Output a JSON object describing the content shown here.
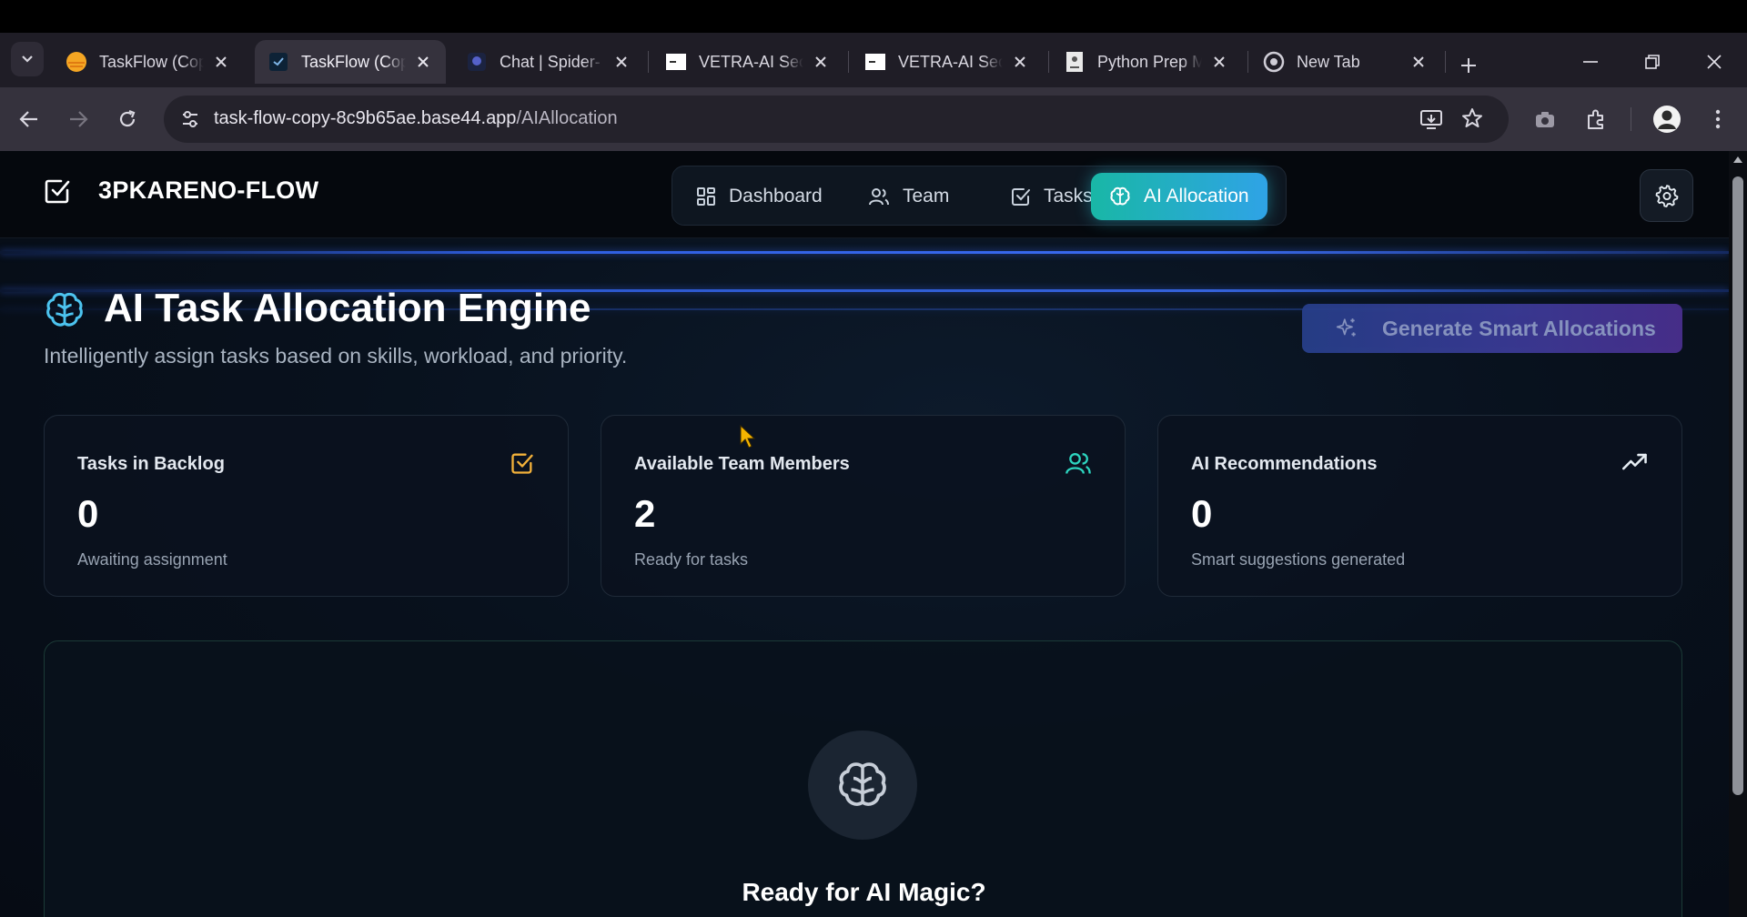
{
  "browser": {
    "tabs": [
      {
        "title": "TaskFlow (Cop",
        "favicon": "orange-circle-icon",
        "active": false
      },
      {
        "title": "TaskFlow (Cop",
        "favicon": "taskflow-icon",
        "active": true
      },
      {
        "title": "Chat | Spider-",
        "favicon": "chat-icon",
        "active": false
      },
      {
        "title": "VETRA-AI Sec",
        "favicon": "page-icon",
        "active": false
      },
      {
        "title": "VETRA-AI Sec",
        "favicon": "page-icon",
        "active": false
      },
      {
        "title": "Python Prep M",
        "favicon": "document-icon",
        "active": false
      },
      {
        "title": "New Tab",
        "favicon": "chrome-icon",
        "active": false
      }
    ],
    "url_host": "task-flow-copy-8c9b65ae.base44.app",
    "url_path": "/AIAllocation"
  },
  "app": {
    "brand": "3PKARENO-FLOW",
    "nav": {
      "dashboard": "Dashboard",
      "team": "Team",
      "tasks": "Tasks",
      "ai_allocation": "AI Allocation"
    },
    "active_nav": "AI Allocation"
  },
  "hero": {
    "title": "AI Task Allocation Engine",
    "subtitle": "Intelligently assign tasks based on skills, workload, and priority.",
    "generate_button": "Generate Smart Allocations"
  },
  "stats": [
    {
      "label": "Tasks in Backlog",
      "value": "0",
      "note": "Awaiting assignment",
      "icon": "check-square-icon",
      "icon_color": "#f2b13a"
    },
    {
      "label": "Available Team Members",
      "value": "2",
      "note": "Ready for tasks",
      "icon": "users-icon",
      "icon_color": "#2dd4bf"
    },
    {
      "label": "AI Recommendations",
      "value": "0",
      "note": "Smart suggestions generated",
      "icon": "trending-up-icon",
      "icon_color": "#e6edf3"
    }
  ],
  "empty_state": {
    "title": "Ready for AI Magic?",
    "icon": "brain-icon"
  },
  "colors": {
    "accent_teal": "#19b7a6",
    "accent_blue": "#2fa3e6",
    "background": "#060b14"
  }
}
